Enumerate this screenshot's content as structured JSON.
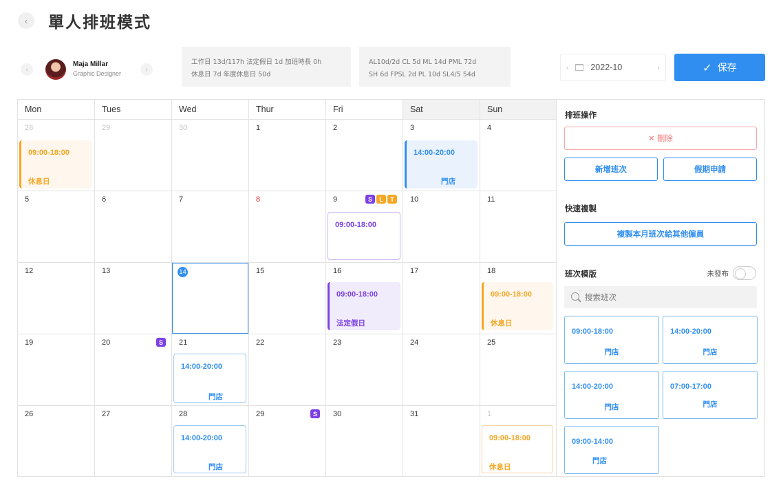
{
  "header": {
    "back": "‹",
    "title": "單人排班模式"
  },
  "employee": {
    "prev": "‹",
    "next": "›",
    "name": "Maja Millar",
    "role": "Graphic Designer"
  },
  "stats": {
    "line1": "工作日 13d/117h  法定假日 1d  加班時長 0h",
    "line2": "休息日 7d  年度休息日 50d"
  },
  "leaves": {
    "line1": "AL10d/2d  CL 5d  ML 14d  PML 72d",
    "line2": "SH 6d  FPSL 2d  PL 10d  SL4/5 54d"
  },
  "month": {
    "prev": "‹",
    "next": "›",
    "value": "2022-10"
  },
  "save": {
    "check": "✓",
    "label": "保存"
  },
  "weekdays": [
    "Mon",
    "Tues",
    "Wed",
    "Thur",
    "Fri",
    "Sat",
    "Sun"
  ],
  "days": [
    "28",
    "29",
    "30",
    "1",
    "2",
    "3",
    "4",
    "5",
    "6",
    "7",
    "8",
    "9",
    "10",
    "11",
    "12",
    "13",
    "",
    "15",
    "16",
    "17",
    "18",
    "19",
    "20",
    "21",
    "22",
    "23",
    "24",
    "25",
    "26",
    "27",
    "28",
    "29",
    "30",
    "31",
    "1"
  ],
  "today": "14",
  "tags": {
    "s": "S",
    "l": "L",
    "t": "T",
    "colors": {
      "s": "#7b3fe4",
      "l": "#f5a623",
      "t": "#f5a623"
    }
  },
  "shifts": [
    {
      "time": "09:00-18:00",
      "label": "休息日"
    },
    {
      "time": "14:00-20:00",
      "label": "門店"
    },
    {
      "time": "09:00-18:00",
      "label": ""
    },
    {
      "time": "09:00-18:00",
      "label": "法定假日"
    },
    {
      "time": "09:00-18:00",
      "label": "休息日"
    },
    {
      "time": "14:00-20:00",
      "label": "門店"
    },
    {
      "time": "14:00-20:00",
      "label": "門店"
    },
    {
      "time": "09:00-18:00",
      "label": "休息日"
    }
  ],
  "panel": {
    "ops_title": "排班操作",
    "delete": "✕ 刪除",
    "add_shift": "新增班次",
    "leave_apply": "假期申請",
    "copy_title": "快速複製",
    "copy_btn": "複製本月班次給其他僱員",
    "tpl_title": "班次模版",
    "unpublished": "未發布",
    "search_placeholder": "搜索班次",
    "templates": [
      {
        "time": "09:00-18:00",
        "label": "門店"
      },
      {
        "time": "14:00-20:00",
        "label": "門店"
      },
      {
        "time": "14:00-20:00",
        "label": "門店"
      },
      {
        "time": "07:00-17:00",
        "label": "門店"
      },
      {
        "time": "09:00-14:00",
        "label": "門店"
      }
    ]
  },
  "colors": {
    "accent": "#2f8ef0",
    "rest": "#f5a623",
    "holiday": "#7b3fe4",
    "danger": "#f07a7a"
  }
}
